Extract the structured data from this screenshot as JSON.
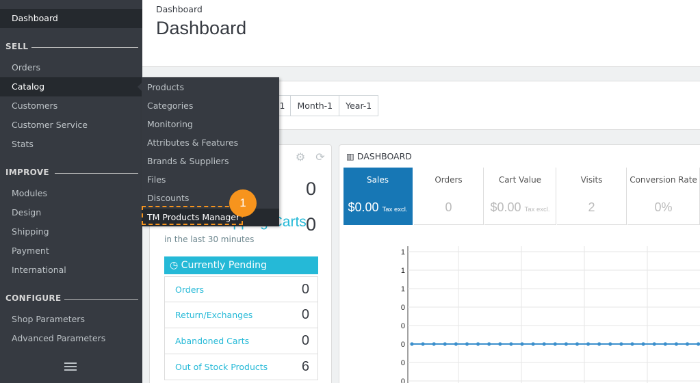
{
  "sidebar": {
    "dashboard": "Dashboard",
    "sections": {
      "sell": "SELL",
      "improve": "IMPROVE",
      "configure": "CONFIGURE"
    },
    "sell_items": [
      "Orders",
      "Catalog",
      "Customers",
      "Customer Service",
      "Stats"
    ],
    "improve_items": [
      "Modules",
      "Design",
      "Shipping",
      "Payment",
      "International"
    ],
    "configure_items": [
      "Shop Parameters",
      "Advanced Parameters"
    ]
  },
  "catalog_menu": {
    "items": [
      "Products",
      "Categories",
      "Monitoring",
      "Attributes & Features",
      "Brands & Suppliers",
      "Files",
      "Discounts",
      "TM Products Manager"
    ],
    "step_badge": "1"
  },
  "header": {
    "breadcrumb": "Dashboard",
    "title": "Dashboard"
  },
  "toolbar": {
    "partial_button": "-1",
    "buttons": [
      "Month-1",
      "Year-1"
    ]
  },
  "activity": {
    "online_count": "0",
    "active_carts_label": "Active Shopping Carts",
    "active_carts_count": "0",
    "active_carts_note": "in the last 30 minutes",
    "pending_title": "Currently Pending",
    "pending_rows": [
      {
        "label": "Orders",
        "value": "0"
      },
      {
        "label": "Return/Exchanges",
        "value": "0"
      },
      {
        "label": "Abandoned Carts",
        "value": "0"
      },
      {
        "label": "Out of Stock Products",
        "value": "6"
      }
    ]
  },
  "dashboard": {
    "title": "DASHBOARD",
    "kpis": [
      {
        "label": "Sales",
        "value": "$0.00",
        "suffix": "Tax excl."
      },
      {
        "label": "Orders",
        "value": "0",
        "suffix": ""
      },
      {
        "label": "Cart Value",
        "value": "$0.00",
        "suffix": "Tax excl."
      },
      {
        "label": "Visits",
        "value": "2",
        "suffix": ""
      },
      {
        "label": "Conversion Rate",
        "value": "0%",
        "suffix": ""
      }
    ]
  },
  "chart_data": {
    "type": "line",
    "ytick_labels": [
      "1",
      "1",
      "1",
      "0",
      "0",
      "0",
      "0",
      "0"
    ],
    "series": [
      {
        "values": [
          0,
          0,
          0,
          0,
          0,
          0,
          0,
          0,
          0,
          0,
          0,
          0,
          0,
          0,
          0,
          0,
          0,
          0,
          0,
          0,
          0,
          0,
          0,
          0,
          0,
          0,
          0,
          0,
          0,
          0
        ]
      }
    ],
    "grid": true,
    "color": "#3b8fcc"
  }
}
